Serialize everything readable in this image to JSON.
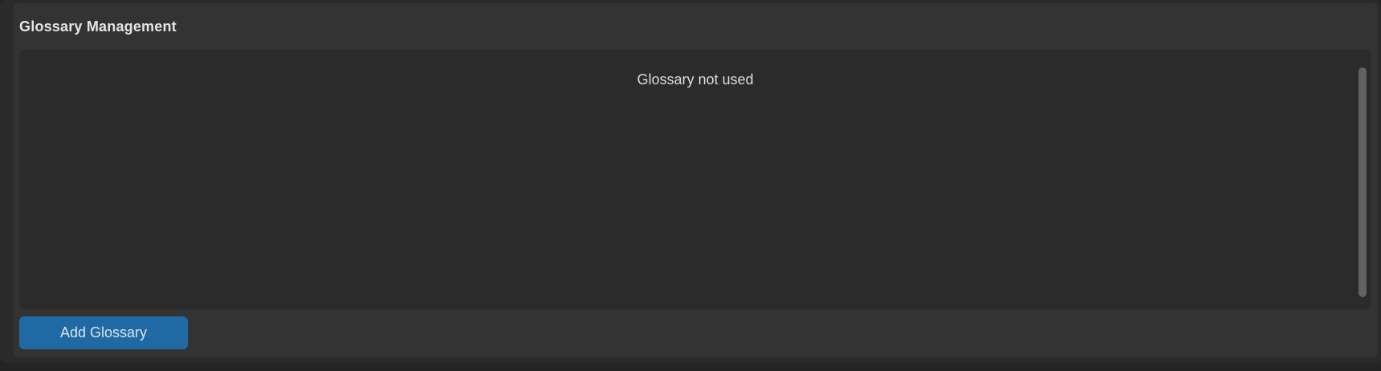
{
  "panel": {
    "title": "Glossary Management"
  },
  "glossary_list": {
    "empty_message": "Glossary not used"
  },
  "actions": {
    "add_label": "Add Glossary"
  },
  "colors": {
    "background": "#242424",
    "panel": "#333333",
    "list_background": "#2b2b2b",
    "accent": "#1f6aa5",
    "scrollbar": "#626262"
  }
}
